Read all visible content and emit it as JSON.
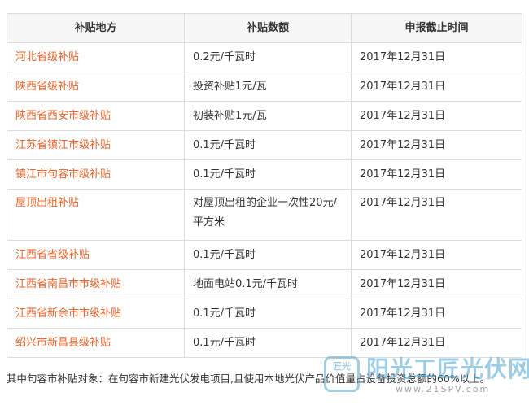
{
  "table": {
    "headers": [
      "补贴地方",
      "补贴数额",
      "申报截止时间"
    ],
    "rows": [
      {
        "place": "河北省级补贴",
        "amount": "0.2元/千瓦时",
        "deadline": "2017年12月31日"
      },
      {
        "place": "陕西省级补贴",
        "amount": "投资补贴1元/瓦",
        "deadline": "2017年12月31日"
      },
      {
        "place": "陕西省西安市级补贴",
        "amount": "初装补贴1元/瓦",
        "deadline": "2017年12月31日"
      },
      {
        "place": "江苏省镇江市级补贴",
        "amount": "0.1元/千瓦时",
        "deadline": "2017年12月31日"
      },
      {
        "place": "镇江市句容市级补贴",
        "amount": "0.1元/千瓦时",
        "deadline": "2017年12月31日"
      },
      {
        "place": "屋顶出租补贴",
        "amount": "对屋顶出租的企业一次性20元/平方米",
        "deadline": "2017年12月31日"
      },
      {
        "place": "江西省省级补贴",
        "amount": "0.1元/千瓦时",
        "deadline": "2017年12月31日"
      },
      {
        "place": "江西省南昌市市级补贴",
        "amount": "地面电站0.1元/千瓦时",
        "deadline": "2017年12月31日"
      },
      {
        "place": "江西省新余市市级补贴",
        "amount": "0.1元/千瓦时",
        "deadline": "2017年12月31日"
      },
      {
        "place": "绍兴市新昌县级补贴",
        "amount": "0.1元/千瓦时",
        "deadline": "2017年12月31日"
      }
    ]
  },
  "note": "其中句容市补贴对象：在句容市新建光伏发电项目,且使用本地光伏产品价值量占设备投资总额的60%以上。",
  "watermark": {
    "logo_text": "匠光",
    "title": "阳光工匠光伏网",
    "url": "www.21SPV.com"
  },
  "colors": {
    "place_text": "#e8642a",
    "border": "#dddddd",
    "watermark_blue": "#4fa3d1"
  }
}
